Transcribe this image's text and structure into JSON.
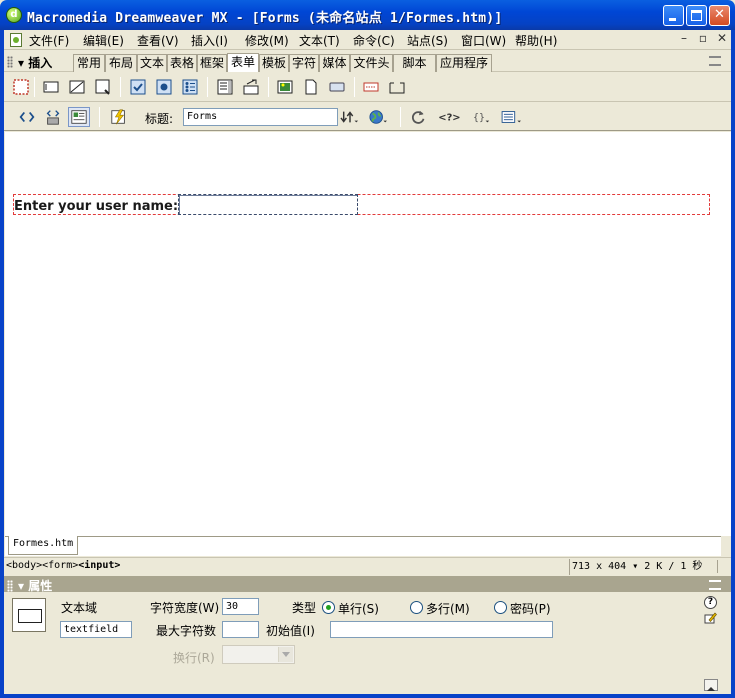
{
  "window": {
    "title": "Macromedia Dreamweaver MX - [Forms (未命名站点 1/Formes.htm)]"
  },
  "menu": {
    "items": [
      "文件(F)",
      "编辑(E)",
      "查看(V)",
      "插入(I)",
      "修改(M)",
      "文本(T)",
      "命令(C)",
      "站点(S)",
      "窗口(W)",
      "帮助(H)"
    ],
    "doc_controls": [
      "–",
      "▫",
      "✕"
    ]
  },
  "insert_panel": {
    "title": "插入",
    "tabs": [
      "常用",
      "布局",
      "文本",
      "表格",
      "框架",
      "表单",
      "模板",
      "字符",
      "媒体",
      "文件头",
      "脚本",
      "应用程序"
    ],
    "active_tab": "表单"
  },
  "doc_toolbar": {
    "title_label": "标题:",
    "title_value": "Forms"
  },
  "design": {
    "label_text": "Enter your user name:"
  },
  "doc_tab": {
    "filename": "Formes.htm"
  },
  "status": {
    "tag_path": [
      "<body>",
      "<form>",
      "<input>"
    ],
    "size": "713 x 404",
    "speed": "2 K / 1 秒"
  },
  "properties": {
    "title": "属性",
    "element_type": "文本域",
    "element_name": "textfield",
    "char_width_label": "字符宽度(W)",
    "char_width_value": "30",
    "max_chars_label": "最大字符数",
    "max_chars_value": "",
    "type_label": "类型",
    "type_options": [
      "单行(S)",
      "多行(M)",
      "密码(P)"
    ],
    "type_selected": "单行(S)",
    "init_value_label": "初始值(I)",
    "init_value": "",
    "wrap_label": "换行(R)",
    "help": "?"
  },
  "colors": {
    "titlebar": "#0046d5",
    "form_outline": "#e23b3b",
    "chrome": "#ece9d8"
  }
}
